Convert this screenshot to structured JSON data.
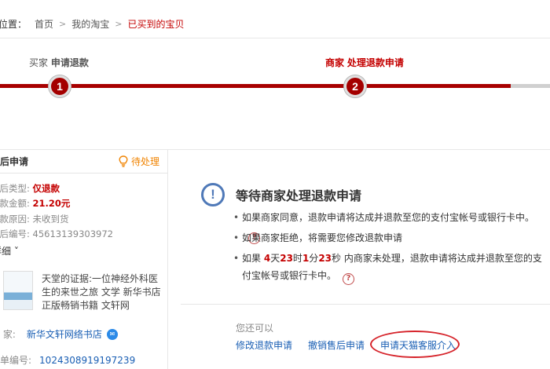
{
  "breadcrumb": {
    "prefix": "的位置：",
    "items": [
      "首页",
      "我的淘宝"
    ],
    "separator": ">",
    "current": "已买到的宝贝"
  },
  "steps": [
    {
      "index": "1",
      "role": "买家",
      "label": "申请退款",
      "active": false
    },
    {
      "index": "2",
      "role": "商家",
      "label": "处理退款申请",
      "active": true
    }
  ],
  "left_panel": {
    "title": "售后申请",
    "status": "待处理",
    "status_icon": "lightbulb-icon",
    "fields": [
      {
        "label": "售后类型:",
        "value": "仅退款"
      },
      {
        "label": "退款金额:",
        "value": "21.20元"
      },
      {
        "label": "退款原因:",
        "value": "未收到货"
      },
      {
        "label": "售后编号:",
        "value": "45613139303972"
      }
    ],
    "detail_toggle": "详细 ˅",
    "product": {
      "title": "天堂的证据:一位神经外科医生的来世之旅 文学 新华书店正版畅销书籍 文轩网"
    },
    "shop_label": "商 家:",
    "shop_name": "新华文轩网络书店",
    "order_label": "订单编号:",
    "order_no": "1024308919197239"
  },
  "main": {
    "title": "等待商家处理退款申请",
    "bullet1": "如果商家同意，退款申请将达成并退款至您的支付宝帐号或银行卡中。",
    "bullet2": "如果商家拒绝，将需要您修改退款申请",
    "bullet3_prefix": "如果",
    "countdown": {
      "days": "4",
      "days_unit": "天",
      "hours": "23",
      "hours_unit": "时",
      "minutes": "1",
      "minutes_unit": "分",
      "seconds": "23",
      "seconds_unit": "秒"
    },
    "bullet3_suffix": "内商家未处理，退款申请将达成并退款至您的支付宝帐号或银行卡中。",
    "also_label": "您还可以",
    "actions": [
      "修改退款申请",
      "撤销售后申请",
      "申请天猫客服介入"
    ]
  },
  "colors": {
    "accent": "#c40000",
    "link": "#1a5fb4",
    "status": "#f08300",
    "highlight": "#d6242b"
  }
}
